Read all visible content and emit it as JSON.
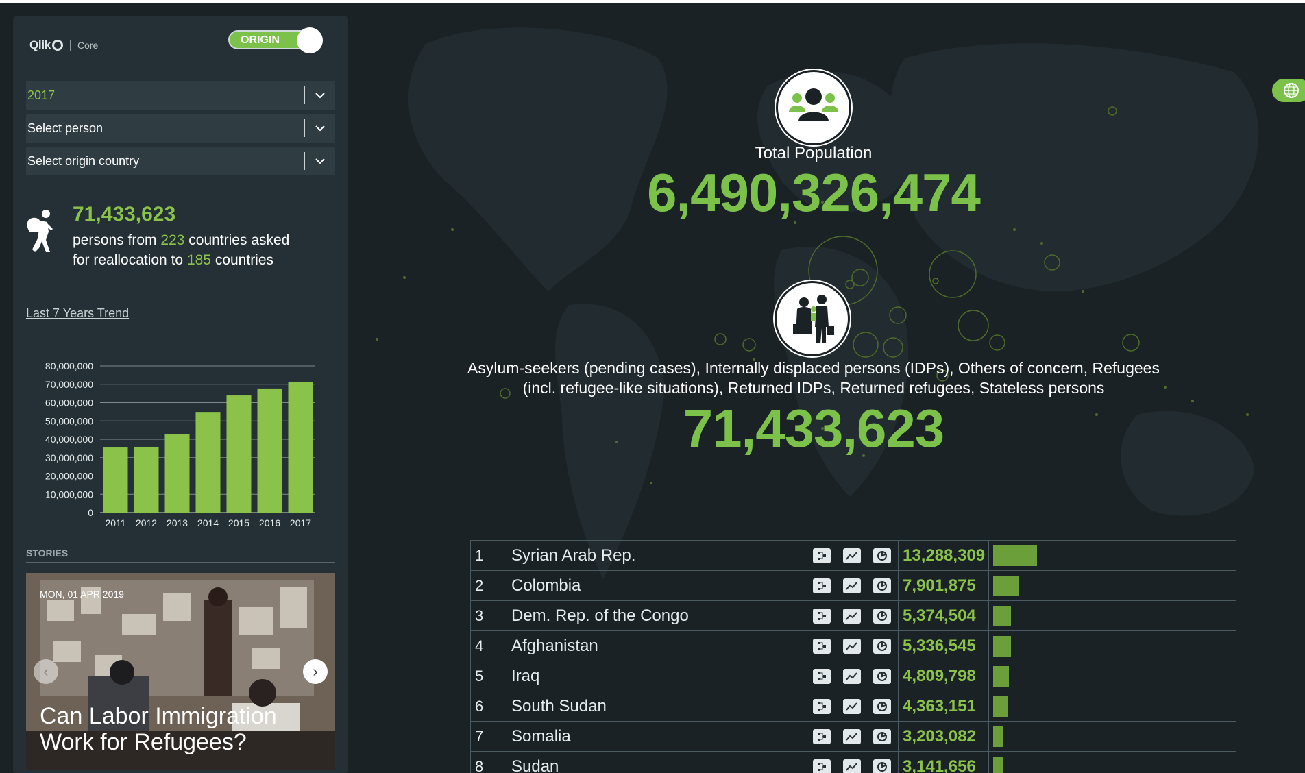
{
  "brand": {
    "name": "Qlik",
    "product": "Core"
  },
  "toggle": {
    "label": "ORIGIN"
  },
  "filters": {
    "year": "2017",
    "person": "Select person",
    "origin": "Select origin country"
  },
  "summary": {
    "total": "71,433,623",
    "line1_pre": "persons from ",
    "from_count": "223",
    "line1_post": " countries asked",
    "line2_pre": "for reallocation to ",
    "to_count": "185",
    "line2_post": " countries"
  },
  "trend": {
    "title": "Last 7 Years Trend"
  },
  "chart_data": {
    "type": "bar",
    "categories": [
      "2011",
      "2012",
      "2013",
      "2014",
      "2015",
      "2016",
      "2017"
    ],
    "values": [
      35500000,
      35900000,
      42900000,
      54900000,
      63900000,
      67700000,
      71400000
    ],
    "ylim": [
      0,
      80000000
    ],
    "yticks": [
      "0",
      "10,000,000",
      "20,000,000",
      "30,000,000",
      "40,000,000",
      "50,000,000",
      "60,000,000",
      "70,000,000",
      "80,000,000"
    ],
    "grid": true,
    "color": "#8bc34a"
  },
  "stories": {
    "label": "STORIES",
    "date": "MON, 01 APR 2019",
    "headline_line1": "Can Labor Immigration",
    "headline_line2": "Work for Refugees?"
  },
  "main": {
    "total_label": "Total Population",
    "total_value": "6,490,326,474",
    "categories_line1": "Asylum-seekers (pending cases), Internally displaced persons (IDPs), Others of concern, Refugees",
    "categories_line2": "(incl. refugee-like situations), Returned IDPs, Returned refugees, Stateless persons",
    "persons_value": "71,433,623"
  },
  "ranking": [
    {
      "rank": "1",
      "country": "Syrian Arab Rep.",
      "value": "13,288,309",
      "share": 1.0
    },
    {
      "rank": "2",
      "country": "Colombia",
      "value": "7,901,875",
      "share": 0.595
    },
    {
      "rank": "3",
      "country": "Dem. Rep. of the Congo",
      "value": "5,374,504",
      "share": 0.404
    },
    {
      "rank": "4",
      "country": "Afghanistan",
      "value": "5,336,545",
      "share": 0.402
    },
    {
      "rank": "5",
      "country": "Iraq",
      "value": "4,809,798",
      "share": 0.362
    },
    {
      "rank": "6",
      "country": "South Sudan",
      "value": "4,363,151",
      "share": 0.328
    },
    {
      "rank": "7",
      "country": "Somalia",
      "value": "3,203,082",
      "share": 0.241
    },
    {
      "rank": "8",
      "country": "Sudan",
      "value": "3,141,656",
      "share": 0.236
    }
  ],
  "icons": {
    "row_icons": [
      "network-icon",
      "trend-icon",
      "pie-icon"
    ],
    "globe": "globe-icon",
    "population": "population-icon",
    "refugee_family": "refugee-family-icon",
    "hiker": "walking-person-icon"
  },
  "colors": {
    "accent": "#7cc24a",
    "background": "#1b2225",
    "panel": "#243035"
  }
}
